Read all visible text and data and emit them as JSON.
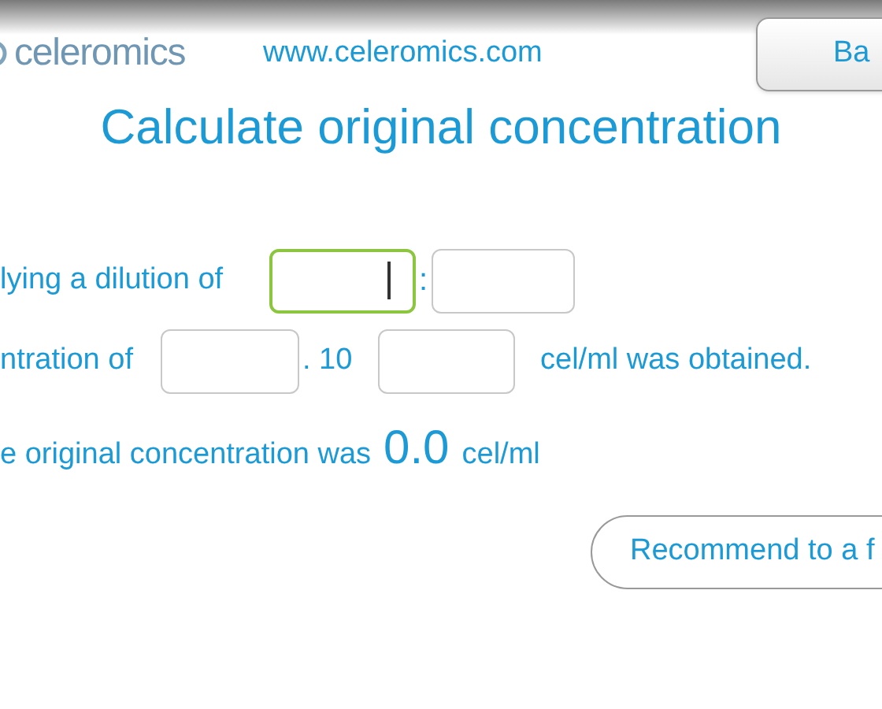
{
  "header": {
    "logo": "celeromics",
    "url": "www.celeromics.com",
    "back_button": "Ba"
  },
  "title": "Calculate original concentration",
  "dilution": {
    "label": "lying a dilution of",
    "separator": ":",
    "fields": [
      {
        "focused": true
      },
      {
        "focused": false
      }
    ]
  },
  "concentration": {
    "label": "ntration of",
    "fields": [
      {
        "focused": false
      },
      {
        "focused": false
      }
    ],
    "multiplier": ". 10",
    "suffix": "cel/ml was obtained."
  },
  "result": {
    "label": "e original concentration was",
    "value": "0.0",
    "unit": "cel/ml"
  },
  "recommend_button": "Recommend to a f"
}
